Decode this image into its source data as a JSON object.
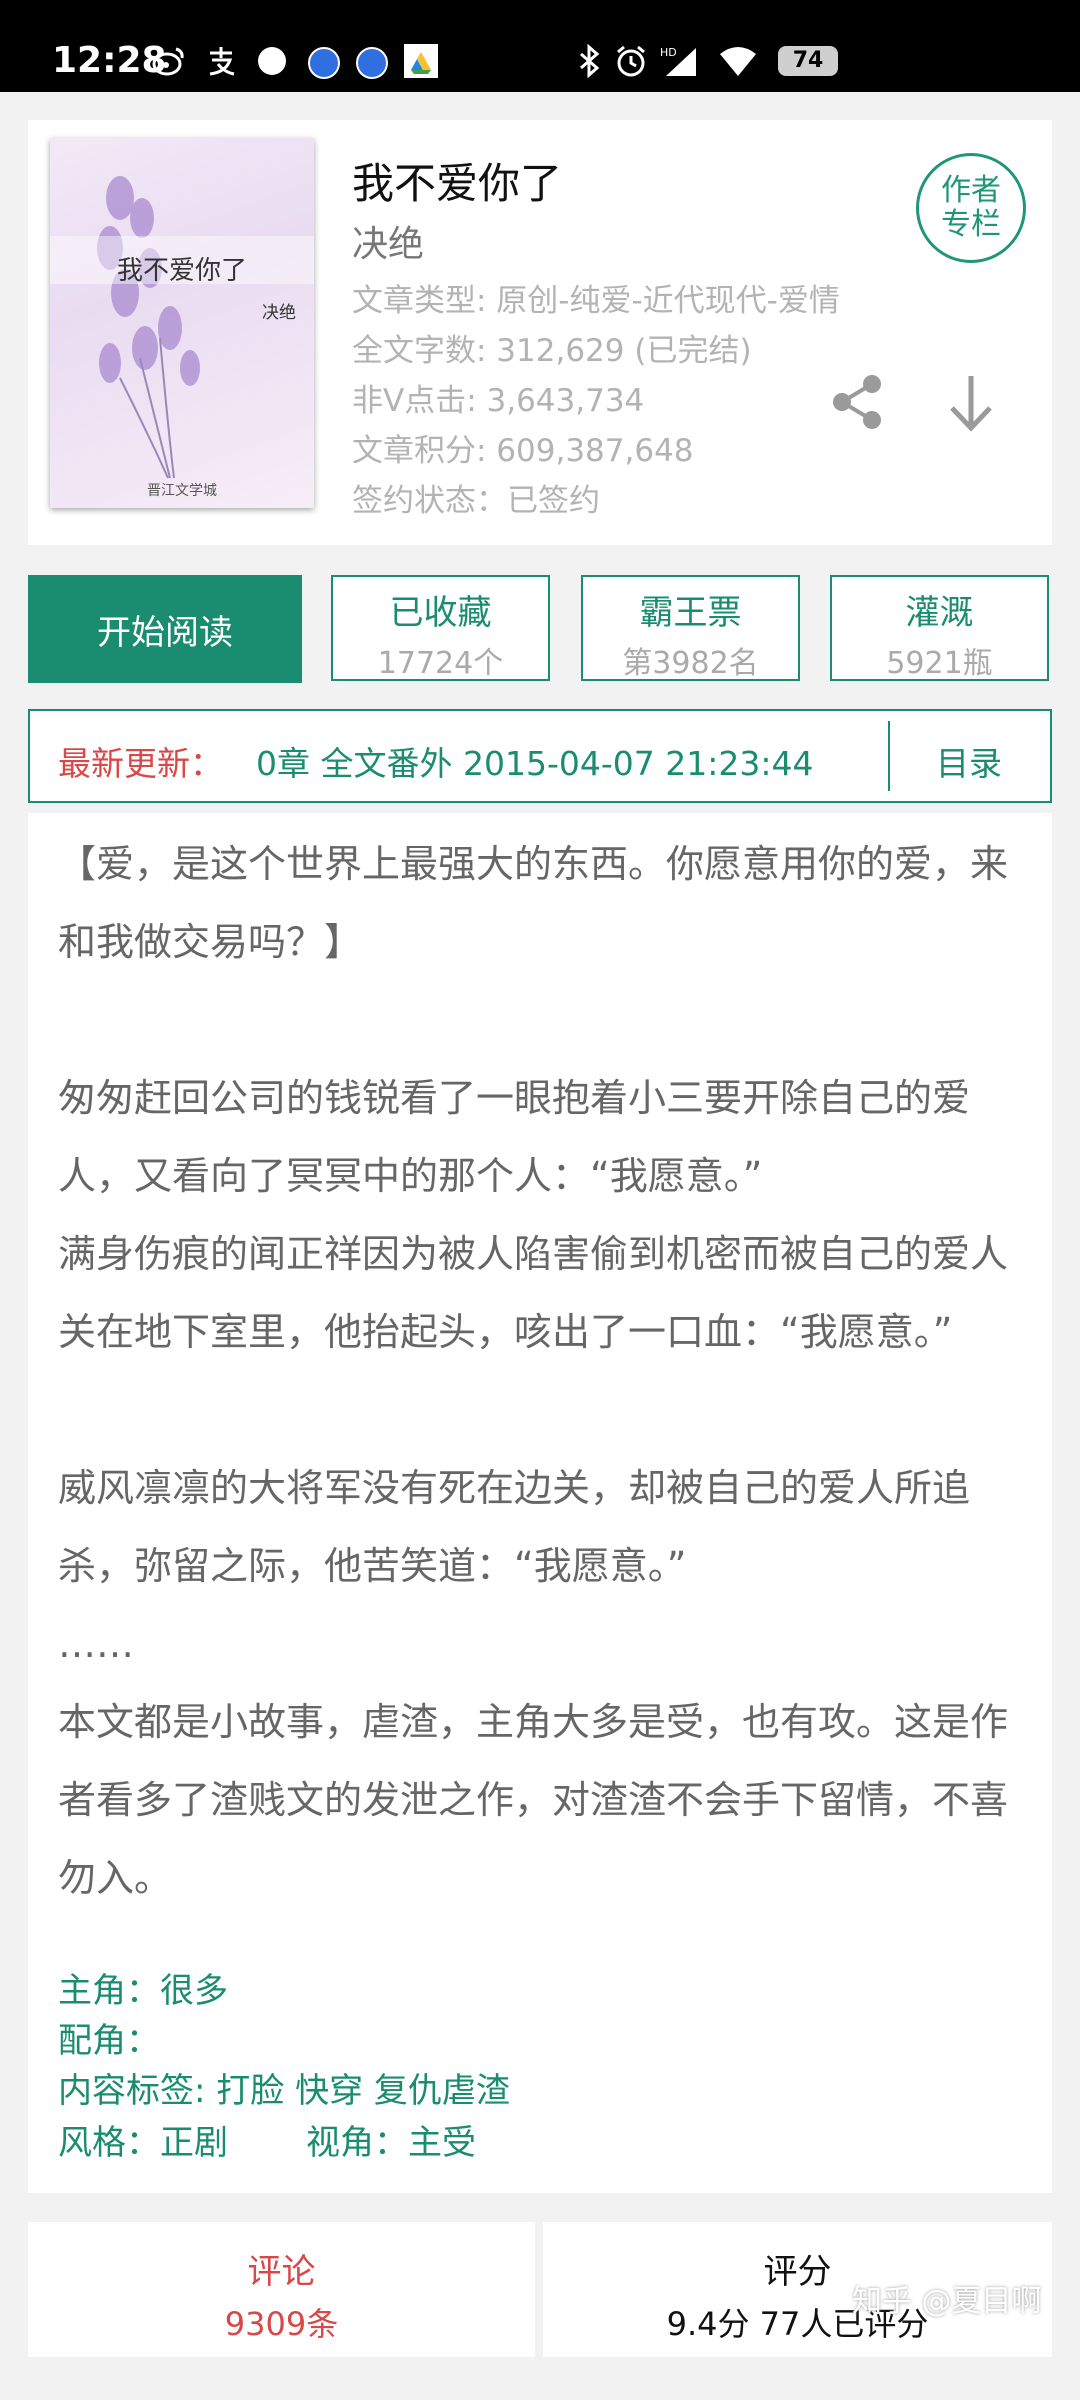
{
  "status_bar": {
    "time": "12:28",
    "battery": "74"
  },
  "book": {
    "cover_title": "我不爱你了",
    "cover_author": "决绝",
    "cover_publisher": "晋江文学城",
    "title": "我不爱你了",
    "author": "决绝",
    "meta": [
      "文章类型: 原创-纯爱-近代现代-爱情",
      "全文字数: 312,629 (已完结)",
      "非Ⅴ点击: 3,643,734",
      "文章积分: 609,387,648",
      "签约状态：已签约"
    ],
    "author_column_line1": "作者",
    "author_column_line2": "专栏"
  },
  "actions": {
    "read_label": "开始阅读",
    "favorite": {
      "label": "已收藏",
      "value": "17724个"
    },
    "ticket": {
      "label": "霸王票",
      "value": "第3982名"
    },
    "nutrient": {
      "label": "灌溉",
      "value": "5921瓶"
    }
  },
  "update": {
    "label": "最新更新：",
    "text": "0章  全文番外  2015-04-07 21:23:44",
    "toc_label": "目录"
  },
  "intro": {
    "paragraphs": [
      "【爱，是这个世界上最强大的东西。你愿意用你的爱，来和我做交易吗？】",
      "匆匆赶回公司的钱锐看了一眼抱着小三要开除自己的爱人，又看向了冥冥中的那个人：“我愿意。”",
      "满身伤痕的闻正祥因为被人陷害偷到机密而被自己的爱人关在地下室里，他抬起头，咳出了一口血：“我愿意。”",
      "威风凛凛的大将军没有死在边关，却被自己的爱人所追杀，弥留之际，他苦笑道：“我愿意。”",
      "……",
      "本文都是小故事，虐渣，主角大多是受，也有攻。这是作者看多了渣贱文的发泄之作，对渣渣不会手下留情，不喜勿入。"
    ],
    "protagonist": "主角：很多",
    "supporting": "配角：",
    "tags": "内容标签: 打脸 快穿 复仇虐渣",
    "style": "风格：正剧",
    "perspective": "视角：主受"
  },
  "bottom": {
    "comments_label": "评论",
    "comments_count": "9309条",
    "rating_label": "评分",
    "rating_value": "9.4分 77人已评分"
  },
  "watermark": "知乎 @夏目啊",
  "colors": {
    "accent": "#1a8c6f",
    "highlight": "#d94848",
    "muted": "#b3b3b3"
  }
}
